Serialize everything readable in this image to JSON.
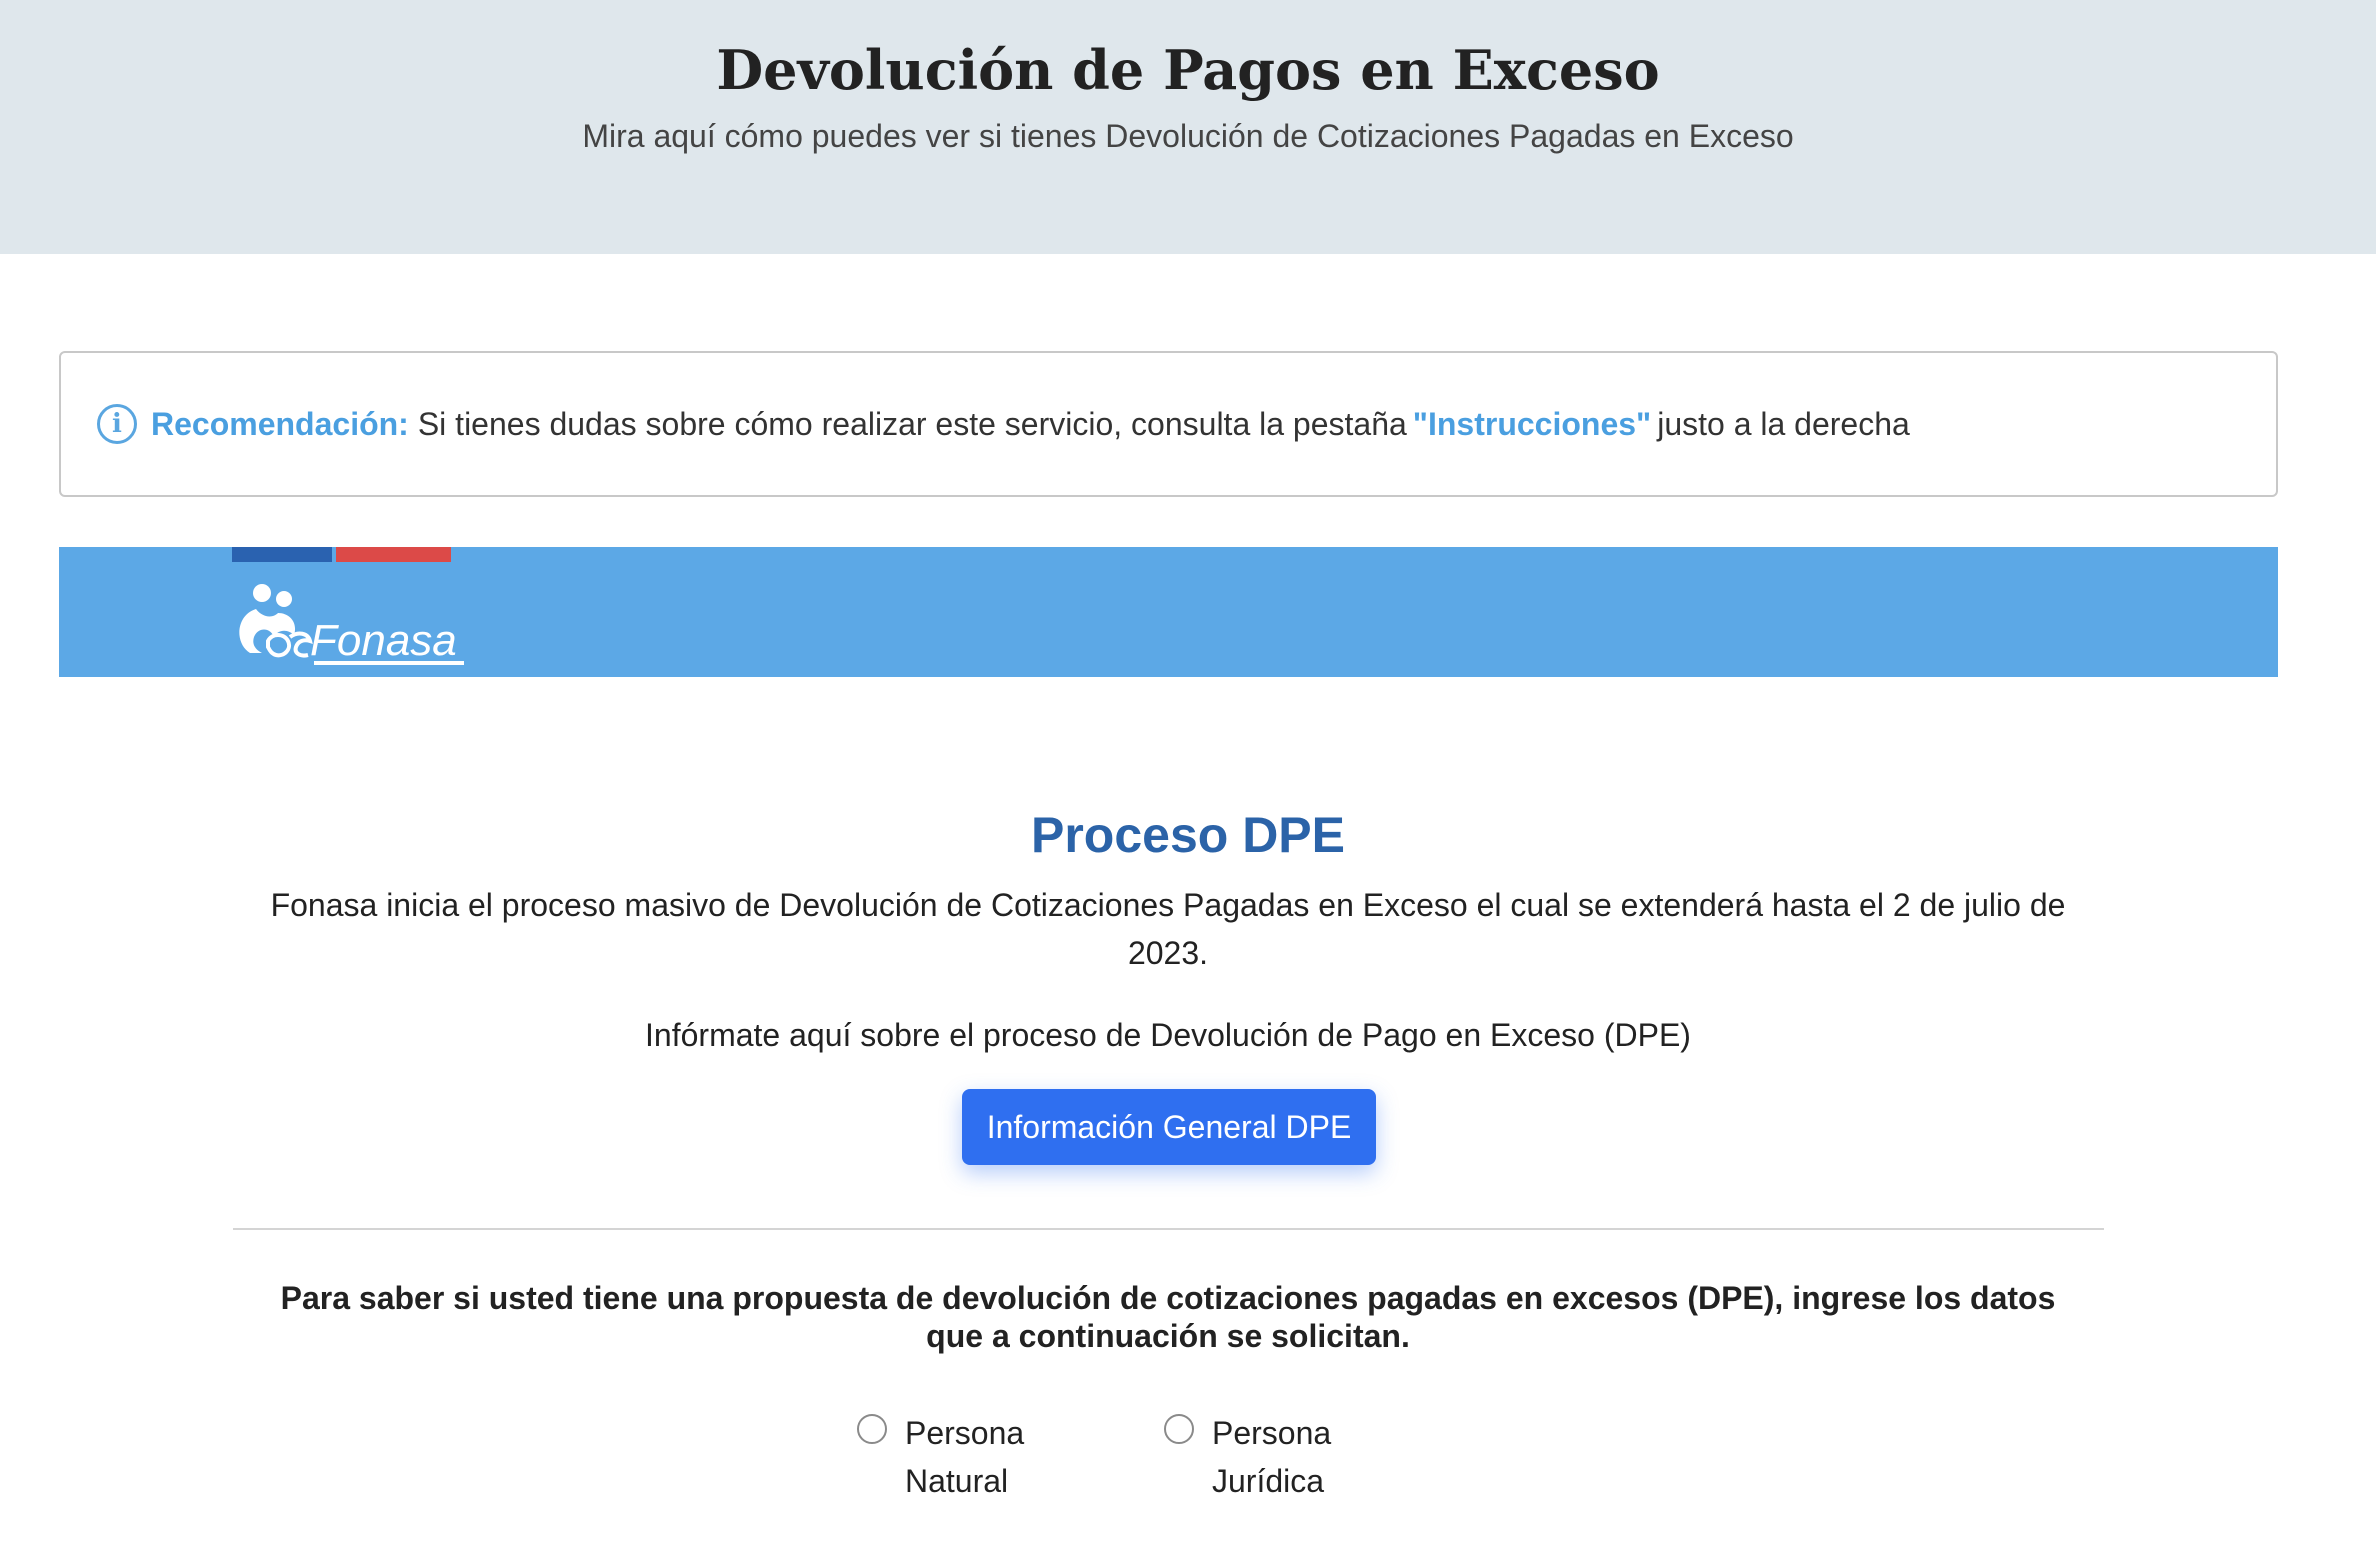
{
  "header": {
    "title": "Devolución de Pagos en Exceso",
    "subtitle": "Mira aquí cómo puedes ver si tienes Devolución de Cotizaciones Pagadas en Exceso"
  },
  "recommendation": {
    "icon": "info-icon",
    "label": "Recomendación:",
    "text_before": "Si tienes dudas sobre cómo realizar este servicio, consulta la pestaña",
    "link": "\"Instrucciones\"",
    "text_after": "justo a la derecha"
  },
  "banner": {
    "logo_text": "Fonasa",
    "colors": {
      "background": "#5ca8e6",
      "flag_blue": "#2a62b0",
      "flag_red": "#dc4a48"
    }
  },
  "main": {
    "title": "Proceso DPE",
    "description": "Fonasa inicia el proceso masivo de Devolución de Cotizaciones Pagadas en Exceso el cual se extenderá hasta el 2 de julio de 2023.",
    "info_text": "Infórmate aquí sobre el proceso de Devolución de Pago en Exceso (DPE)",
    "info_button": "Información General DPE",
    "question": "Para saber si usted tiene una propuesta de devolución de cotizaciones pagadas en excesos (DPE), ingrese los datos que a continuación se solicitan.",
    "person_type_options": [
      "Persona Natural",
      "Persona Jurídica"
    ]
  },
  "colors": {
    "accent": "#2f6ff0",
    "title_blue": "#2b63a8",
    "link_blue": "#4a9fe0",
    "header_bg": "#dfe7ec"
  }
}
